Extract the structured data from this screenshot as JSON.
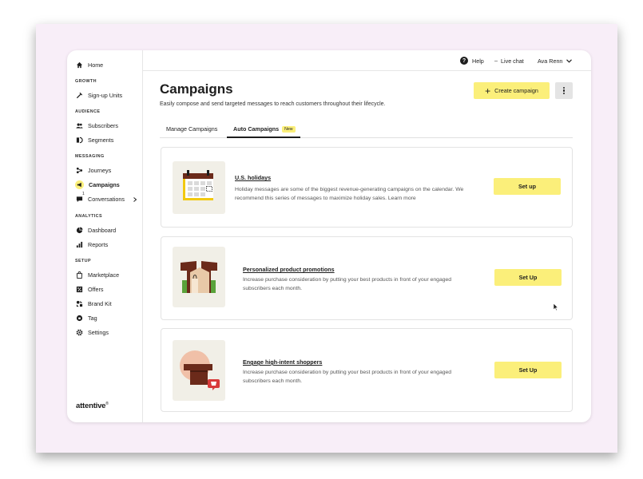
{
  "sidebar": {
    "home": "Home",
    "sections": {
      "growth": "GROWTH",
      "audience": "AUDIENCE",
      "messaging": "MESSAGING",
      "analytics": "ANALYTICS",
      "setup": "SETUP"
    },
    "items": {
      "signup_units": "Sign-up Units",
      "subscribers": "Subscribers",
      "segments": "Segments",
      "journeys": "Journeys",
      "campaigns": "Campaigns",
      "conversations": "Conversations",
      "dashboard": "Dashboard",
      "reports": "Reports",
      "marketplace": "Marketplace",
      "offers": "Offers",
      "brand_kit": "Brand Kit",
      "tag": "Tag",
      "settings": "Settings"
    },
    "conversations_badge": "1",
    "logo": "attentive"
  },
  "topbar": {
    "help": "Help",
    "live_chat": "Live chat",
    "user": "Ava Renn"
  },
  "page": {
    "title": "Campaigns",
    "subtitle": "Easily compose and send targeted messages to reach customers throughout their lifecycle.",
    "create_button": "Create campaign"
  },
  "tabs": {
    "manage": "Manage Campaigns",
    "auto": "Auto Campaigns",
    "new_badge": "New"
  },
  "cards": [
    {
      "title": "U.S. holidays",
      "description": "Holiday messages are some of the biggest revenue-generating campaigns on the calendar. We recommend this series of messages to maximize holiday sales. Learn more",
      "button": "Set up"
    },
    {
      "title": "Personalized product promotions",
      "description": "Increase purchase consideration by putting your best products in front of your engaged subscribers each month.",
      "button": "Set Up"
    },
    {
      "title": "Engage high-intent shoppers",
      "description": "Increase purchase consideration by putting your best products in front of your engaged subscribers each month.",
      "button": "Set Up"
    }
  ],
  "colors": {
    "accent_yellow": "#fbef7a",
    "frame_pink": "#f8eef8",
    "illustration_brown": "#6b2a1a",
    "illustration_green": "#5aa23a",
    "illustration_red": "#d83a3a"
  }
}
